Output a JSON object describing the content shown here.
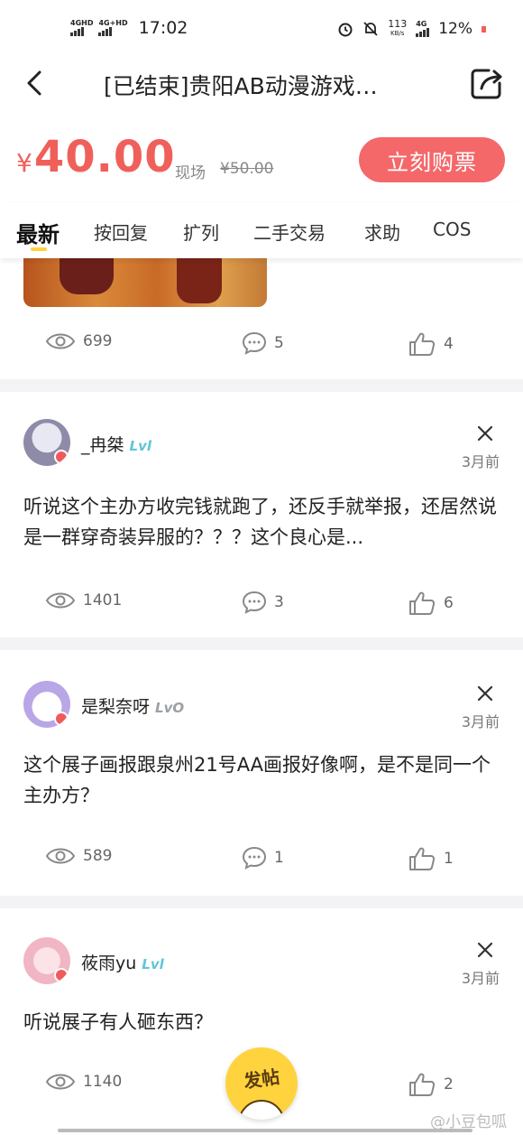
{
  "status_bar": {
    "net1": "4GHD",
    "net2": "4G+HD",
    "time": "17:02",
    "speed_value": "113",
    "speed_unit": "KB/s",
    "net3": "4G",
    "battery": "12%"
  },
  "nav": {
    "title": "[已结束]贵阳AB动漫游戏…"
  },
  "price_bar": {
    "currency": "¥",
    "price": "40.00",
    "onsite_label": "现场",
    "onsite_price": "¥50.00",
    "buy_label": "立刻购票"
  },
  "tabs": [
    {
      "label": "最新",
      "active": true
    },
    {
      "label": "按回复"
    },
    {
      "label": "扩列"
    },
    {
      "label": "二手交易"
    },
    {
      "label": "求助"
    },
    {
      "label": "COS"
    }
  ],
  "colors": {
    "accent": "#f0605a",
    "tab_underline": "#ffd23c",
    "level_badge": "#5ec5d8"
  },
  "posts": [
    {
      "views": "699",
      "comments": "5",
      "likes": "4"
    },
    {
      "username": "_冉桀",
      "level": "Lvl",
      "time": "3月前",
      "text": "听说这个主办方收完钱就跑了，还反手就举报，还居然说是一群穿奇装异服的？？？这个良心是...",
      "views": "1401",
      "comments": "3",
      "likes": "6"
    },
    {
      "username": "是梨奈呀",
      "level": "LvO",
      "time": "3月前",
      "text": "这个展子画报跟泉州21号AA画报好像啊，是不是同一个主办方？",
      "views": "589",
      "comments": "1",
      "likes": "1"
    },
    {
      "username": "莜雨yu",
      "level": "Lvl",
      "time": "3月前",
      "text": "听说展子有人砸东西？",
      "views": "1140",
      "likes": "2"
    }
  ],
  "fab_label": "发帖",
  "watermark": "@小豆包呱"
}
